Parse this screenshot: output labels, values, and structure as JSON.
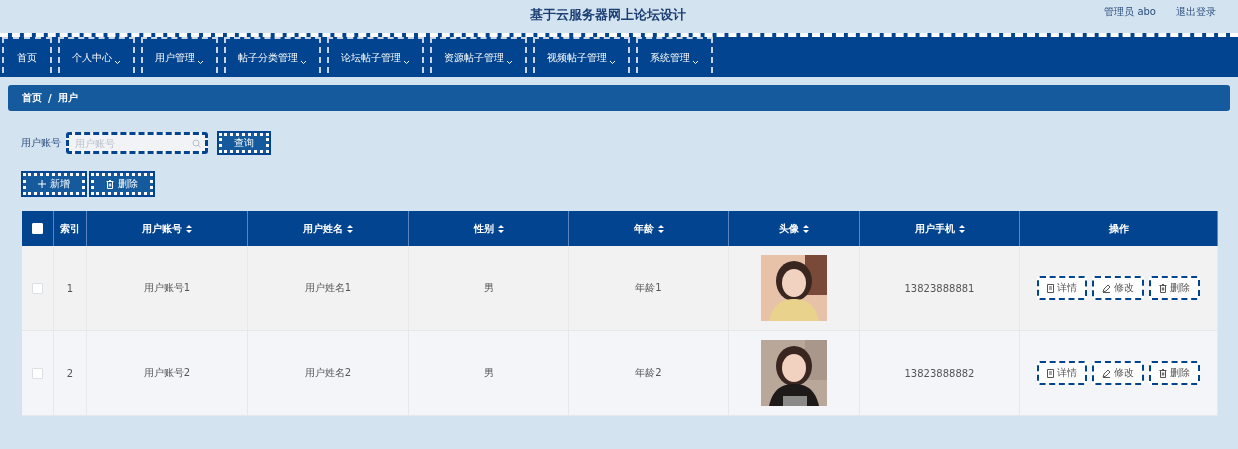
{
  "header": {
    "title": "基于云服务器网上论坛设计",
    "user": "管理员 abo",
    "logout": "退出登录"
  },
  "nav": [
    {
      "label": "首页",
      "dropdown": false
    },
    {
      "label": "个人中心",
      "dropdown": true
    },
    {
      "label": "用户管理",
      "dropdown": true
    },
    {
      "label": "帖子分类管理",
      "dropdown": true
    },
    {
      "label": "论坛帖子管理",
      "dropdown": true
    },
    {
      "label": "资源帖子管理",
      "dropdown": true
    },
    {
      "label": "视频帖子管理",
      "dropdown": true
    },
    {
      "label": "系统管理",
      "dropdown": true
    }
  ],
  "breadcrumb": {
    "items": [
      "首页",
      "用户"
    ],
    "separator": "/"
  },
  "search": {
    "label": "用户账号",
    "placeholder": "用户账号",
    "button": "查询"
  },
  "actions": [
    {
      "kind": "add",
      "label": "新增"
    },
    {
      "kind": "delete",
      "label": "删除"
    }
  ],
  "table": {
    "select_all": false,
    "columns": [
      {
        "label": "索引",
        "sortable": false
      },
      {
        "label": "用户账号",
        "sortable": true
      },
      {
        "label": "用户姓名",
        "sortable": true
      },
      {
        "label": "性别",
        "sortable": true
      },
      {
        "label": "年龄",
        "sortable": true
      },
      {
        "label": "头像",
        "sortable": true
      },
      {
        "label": "用户手机",
        "sortable": true
      },
      {
        "label": "操作",
        "sortable": false
      }
    ],
    "rows": [
      {
        "checked": false,
        "index": "1",
        "account": "用户账号1",
        "name": "用户姓名1",
        "sex": "男",
        "age": "年龄1",
        "phone": "13823888881",
        "buttons": [
          {
            "kind": "detail",
            "label": "详情"
          },
          {
            "kind": "edit",
            "label": "修改"
          },
          {
            "kind": "delete",
            "label": "删除"
          }
        ]
      },
      {
        "checked": false,
        "index": "2",
        "account": "用户账号2",
        "name": "用户姓名2",
        "sex": "男",
        "age": "年龄2",
        "phone": "13823888882",
        "buttons": [
          {
            "kind": "detail",
            "label": "详情"
          },
          {
            "kind": "edit",
            "label": "修改"
          },
          {
            "kind": "delete",
            "label": "删除"
          }
        ]
      }
    ]
  }
}
